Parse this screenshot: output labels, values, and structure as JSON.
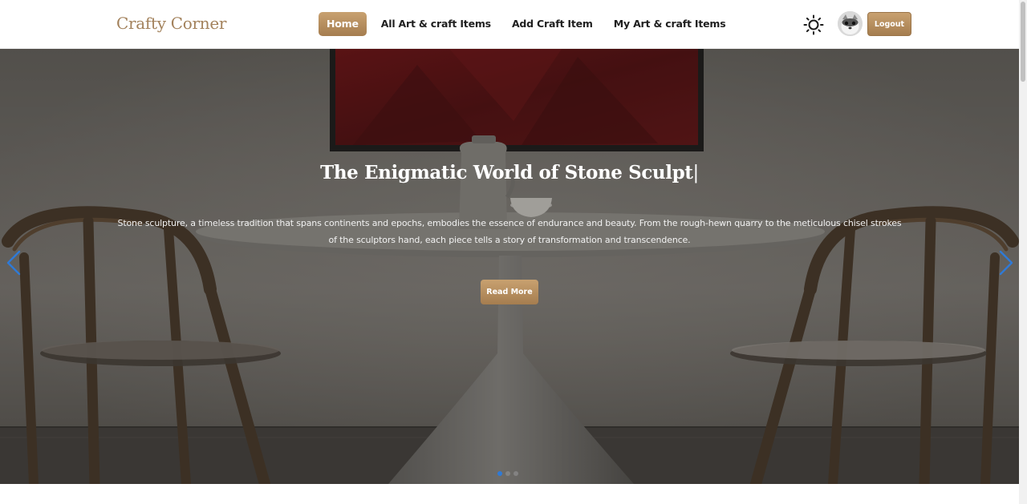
{
  "header": {
    "brand": "Crafty Corner",
    "nav": [
      {
        "label": "Home",
        "active": true
      },
      {
        "label": "All Art & craft Items",
        "active": false
      },
      {
        "label": "Add Craft Item",
        "active": false
      },
      {
        "label": "My Art & craft Items",
        "active": false
      }
    ],
    "theme_icon": "sun-icon",
    "avatar_icon": "user-avatar",
    "logout_label": "Logout"
  },
  "hero": {
    "title": "The Enigmatic World of Stone Sculpt",
    "cursor": "|",
    "description": "Stone sculpture, a timeless tradition that spans continents and epochs, embodies the essence of endurance and beauty. From the rough-hewn quarry to the meticulous chisel strokes of the sculptors hand, each piece tells a story of transformation and transcendence.",
    "button_label": "Read More",
    "prev_icon": "chevron-left-icon",
    "next_icon": "chevron-right-icon",
    "slides_count": 3,
    "active_slide": 1
  },
  "colors": {
    "accent": "#b48d60",
    "brand_text": "#a3825c",
    "pagination_active": "#2f7ad6",
    "arrow": "#2f7ad6"
  }
}
